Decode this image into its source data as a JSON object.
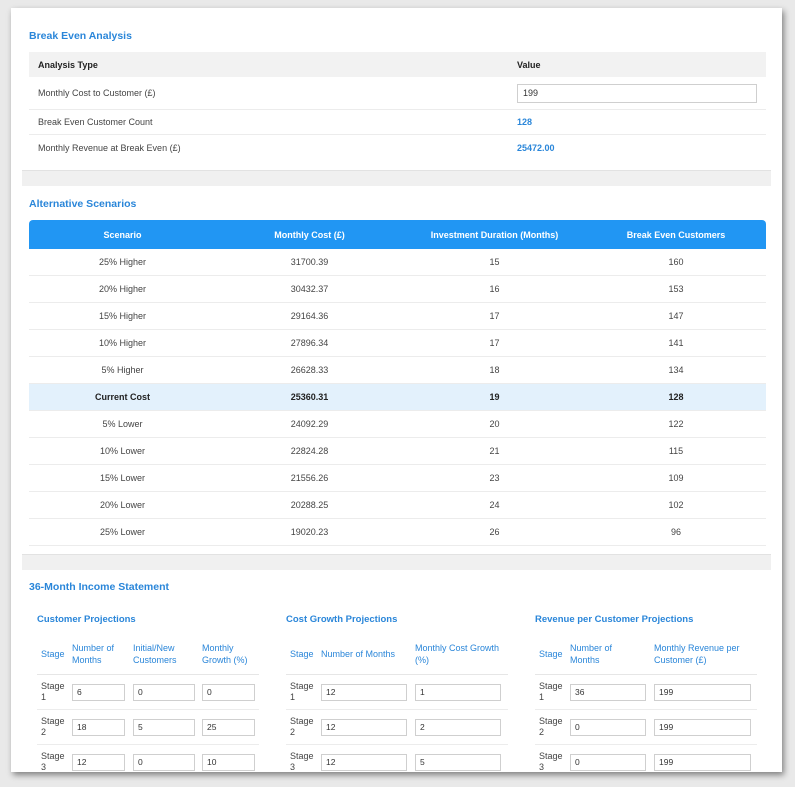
{
  "break_even": {
    "title": "Break Even Analysis",
    "col_type": "Analysis Type",
    "col_value": "Value",
    "rows": [
      {
        "label": "Monthly Cost to Customer (£)",
        "value": "199"
      },
      {
        "label": "Break Even Customer Count",
        "value": "128"
      },
      {
        "label": "Monthly Revenue at Break Even (£)",
        "value": "25472.00"
      }
    ]
  },
  "scenarios": {
    "title": "Alternative Scenarios",
    "headers": [
      "Scenario",
      "Monthly Cost (£)",
      "Investment Duration (Months)",
      "Break Even Customers"
    ],
    "rows": [
      [
        "25% Higher",
        "31700.39",
        "15",
        "160"
      ],
      [
        "20% Higher",
        "30432.37",
        "16",
        "153"
      ],
      [
        "15% Higher",
        "29164.36",
        "17",
        "147"
      ],
      [
        "10% Higher",
        "27896.34",
        "17",
        "141"
      ],
      [
        "5% Higher",
        "26628.33",
        "18",
        "134"
      ],
      [
        "Current Cost",
        "25360.31",
        "19",
        "128"
      ],
      [
        "5% Lower",
        "24092.29",
        "20",
        "122"
      ],
      [
        "10% Lower",
        "22824.28",
        "21",
        "115"
      ],
      [
        "15% Lower",
        "21556.26",
        "23",
        "109"
      ],
      [
        "20% Lower",
        "20288.25",
        "24",
        "102"
      ],
      [
        "25% Lower",
        "19020.23",
        "26",
        "96"
      ]
    ]
  },
  "income_statement": {
    "title": "36-Month Income Statement",
    "customer_projections": {
      "title": "Customer Projections",
      "headers": [
        "Stage",
        "Number of Months",
        "Initial/New Customers",
        "Monthly Growth (%)"
      ],
      "rows": [
        {
          "stage": "Stage 1",
          "months": "6",
          "customers": "0",
          "growth": "0"
        },
        {
          "stage": "Stage 2",
          "months": "18",
          "customers": "5",
          "growth": "25"
        },
        {
          "stage": "Stage 3",
          "months": "12",
          "customers": "0",
          "growth": "10"
        }
      ]
    },
    "cost_growth_projections": {
      "title": "Cost Growth Projections",
      "headers": [
        "Stage",
        "Number of Months",
        "Monthly Cost Growth (%)"
      ],
      "rows": [
        {
          "stage": "Stage 1",
          "months": "12",
          "growth": "1"
        },
        {
          "stage": "Stage 2",
          "months": "12",
          "growth": "2"
        },
        {
          "stage": "Stage 3",
          "months": "12",
          "growth": "5"
        }
      ]
    },
    "revenue_projections": {
      "title": "Revenue per Customer Projections",
      "headers": [
        "Stage",
        "Number of Months",
        "Monthly Revenue per Customer (£)"
      ],
      "rows": [
        {
          "stage": "Stage 1",
          "months": "36",
          "revenue": "199"
        },
        {
          "stage": "Stage 2",
          "months": "0",
          "revenue": "199"
        },
        {
          "stage": "Stage 3",
          "months": "0",
          "revenue": "199"
        }
      ]
    }
  },
  "colors": {
    "accent": "#2196f3",
    "title_blue": "#2a86d9",
    "highlight_row": "#e3f1fc"
  }
}
